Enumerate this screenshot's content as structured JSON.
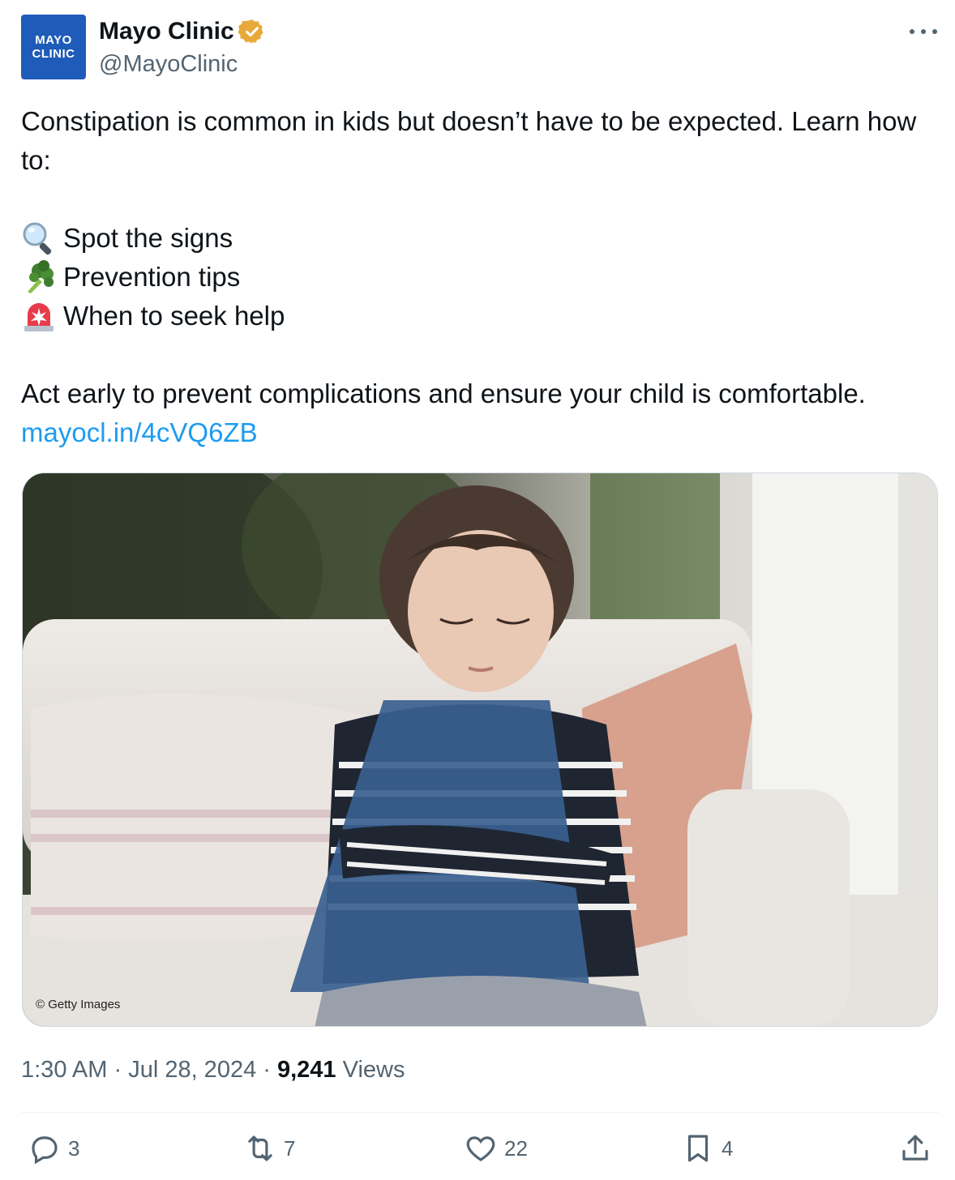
{
  "author": {
    "avatar_line1": "MAYO",
    "avatar_line2": "CLINIC",
    "display_name": "Mayo Clinic",
    "handle": "@MayoClinic",
    "verified_color": "#e8a93b"
  },
  "tweet": {
    "intro": "Constipation is common in kids but doesn’t have to be expected. Learn how to:",
    "bullets": [
      {
        "icon": "magnifying-glass-icon",
        "text": "Spot the signs"
      },
      {
        "icon": "broccoli-icon",
        "text": "Prevention tips"
      },
      {
        "icon": "siren-icon",
        "text": "When to seek help"
      }
    ],
    "closing": "Act early to prevent complications and ensure your child is comfortable.",
    "link": "mayocl.in/4cVQ6ZB"
  },
  "media": {
    "credit": "© Getty Images"
  },
  "meta": {
    "time": "1:30 AM",
    "separator": " · ",
    "date": "Jul 28, 2024",
    "views_count": "9,241",
    "views_label": " Views"
  },
  "actions": {
    "replies": "3",
    "reposts": "7",
    "likes": "22",
    "bookmarks": "4"
  },
  "colors": {
    "accent": "#1d9bf0",
    "text": "#0f1419",
    "secondary": "#536471",
    "avatar_bg": "#1f5bb8"
  }
}
